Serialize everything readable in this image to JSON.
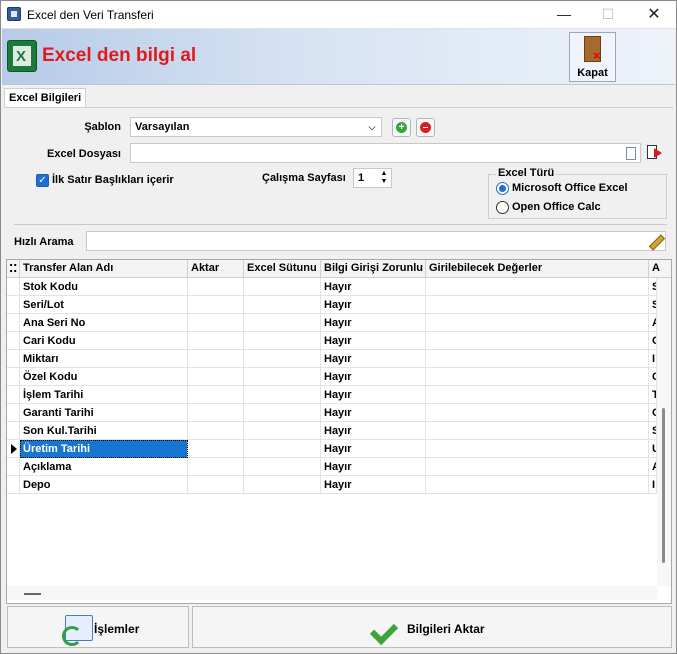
{
  "window": {
    "title": "Excel den Veri Transferi",
    "controls": {
      "minimize": "—",
      "maximize": "☐",
      "close": "✕"
    }
  },
  "banner": {
    "heading": "Excel den bilgi al",
    "close_label": "Kapat"
  },
  "tabs": [
    {
      "label": "Excel Bilgileri",
      "active": true
    }
  ],
  "form": {
    "template_label": "Şablon",
    "template_value": "Varsayılan",
    "file_label": "Excel Dosyası",
    "file_value": "",
    "first_row_header_label": "İlk Satır Başlıkları içerir",
    "first_row_header_checked": true,
    "sheet_label": "Çalışma Sayfası",
    "sheet_value": "1",
    "excel_type": {
      "title": "Excel Türü",
      "options": [
        {
          "label": "Microsoft Office Excel",
          "selected": true
        },
        {
          "label": "Open Office Calc",
          "selected": false
        }
      ]
    },
    "quick_search_label": "Hızlı Arama",
    "quick_search_value": ""
  },
  "grid": {
    "columns": [
      "Transfer Alan Adı",
      "Aktar",
      "Excel Sütunu",
      "Bilgi Girişi Zorunlu",
      "Girilebilecek Değerler",
      "A"
    ],
    "rows": [
      {
        "name": "Stok Kodu",
        "aktar": "",
        "excel_col": "",
        "required": "Hayır",
        "values": "",
        "extra": "S"
      },
      {
        "name": "Seri/Lot",
        "aktar": "",
        "excel_col": "",
        "required": "Hayır",
        "values": "",
        "extra": "S"
      },
      {
        "name": "Ana Seri No",
        "aktar": "",
        "excel_col": "",
        "required": "Hayır",
        "values": "",
        "extra": "A"
      },
      {
        "name": "Cari Kodu",
        "aktar": "",
        "excel_col": "",
        "required": "Hayır",
        "values": "",
        "extra": "C"
      },
      {
        "name": "Miktarı",
        "aktar": "",
        "excel_col": "",
        "required": "Hayır",
        "values": "",
        "extra": "I"
      },
      {
        "name": "Özel Kodu",
        "aktar": "",
        "excel_col": "",
        "required": "Hayır",
        "values": "",
        "extra": "C"
      },
      {
        "name": "İşlem Tarihi",
        "aktar": "",
        "excel_col": "",
        "required": "Hayır",
        "values": "",
        "extra": "T"
      },
      {
        "name": "Garanti Tarihi",
        "aktar": "",
        "excel_col": "",
        "required": "Hayır",
        "values": "",
        "extra": "C"
      },
      {
        "name": "Son Kul.Tarihi",
        "aktar": "",
        "excel_col": "",
        "required": "Hayır",
        "values": "",
        "extra": "S"
      },
      {
        "name": "Üretim Tarihi",
        "aktar": "",
        "excel_col": "",
        "required": "Hayır",
        "values": "",
        "extra": "U",
        "selected": true
      },
      {
        "name": "Açıklama",
        "aktar": "",
        "excel_col": "",
        "required": "Hayır",
        "values": "",
        "extra": "A"
      },
      {
        "name": "Depo",
        "aktar": "",
        "excel_col": "",
        "required": "Hayır",
        "values": "",
        "extra": "I"
      }
    ]
  },
  "footer": {
    "operations_label": "İşlemler",
    "transfer_label": "Bilgileri Aktar"
  }
}
